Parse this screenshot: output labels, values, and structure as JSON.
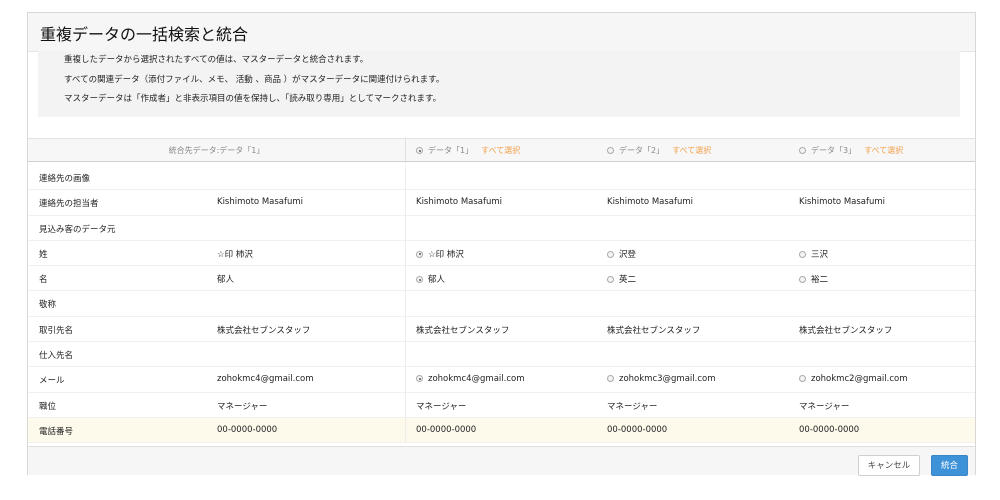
{
  "dialog": {
    "title": "重複データの一括検索と統合",
    "notice": [
      "重複したデータから選択されたすべての値は、マスターデータと統合されます。",
      "すべての関連データ（添付ファイル、メモ、 活動 、商品 ）がマスターデータに関連付けられます。",
      "マスターデータは「作成者」と非表示項目の値を保持し、「読み取り専用」としてマークされます。"
    ]
  },
  "columns": {
    "merged": "統合先データ:データ「1」",
    "select_all": "すべて選択",
    "records": [
      {
        "label": "データ「1」",
        "selected": true
      },
      {
        "label": "データ「2」",
        "selected": false
      },
      {
        "label": "データ「3」",
        "selected": false
      }
    ]
  },
  "rows": [
    {
      "label": "連絡先の画像",
      "merged": "",
      "values": [
        "",
        "",
        ""
      ],
      "radio": false
    },
    {
      "label": "連絡先の担当者",
      "merged": "Kishimoto Masafumi",
      "values": [
        "Kishimoto Masafumi",
        "Kishimoto Masafumi",
        "Kishimoto Masafumi"
      ],
      "radio": false
    },
    {
      "label": "見込み客のデータ元",
      "merged": "",
      "values": [
        "",
        "",
        ""
      ],
      "radio": false
    },
    {
      "label": "姓",
      "merged": "☆印 柿沢",
      "values": [
        "☆印 柿沢",
        "沢登",
        "三沢"
      ],
      "radio": true,
      "checked": 0
    },
    {
      "label": "名",
      "merged": "郁人",
      "values": [
        "郁人",
        "英二",
        "裕二"
      ],
      "radio": true,
      "checked": 0
    },
    {
      "label": "敬称",
      "merged": "",
      "values": [
        "",
        "",
        ""
      ],
      "radio": false
    },
    {
      "label": "取引先名",
      "merged": "株式会社セブンスタッフ",
      "values": [
        "株式会社セブンスタッフ",
        "株式会社セブンスタッフ",
        "株式会社セブンスタッフ"
      ],
      "radio": false
    },
    {
      "label": "仕入先名",
      "merged": "",
      "values": [
        "",
        "",
        ""
      ],
      "radio": false
    },
    {
      "label": "メール",
      "merged": "zohokmc4@gmail.com",
      "values": [
        "zohokmc4@gmail.com",
        "zohokmc3@gmail.com",
        "zohokmc2@gmail.com"
      ],
      "radio": true,
      "checked": 0
    },
    {
      "label": "職位",
      "merged": "マネージャー",
      "values": [
        "マネージャー",
        "マネージャー",
        "マネージャー"
      ],
      "radio": false
    },
    {
      "label": "電話番号",
      "merged": "00-0000-0000",
      "values": [
        "00-0000-0000",
        "00-0000-0000",
        "00-0000-0000"
      ],
      "radio": false,
      "highlight": true
    }
  ],
  "footer": {
    "cancel_label": "キャンセル",
    "merge_label": "統合"
  }
}
